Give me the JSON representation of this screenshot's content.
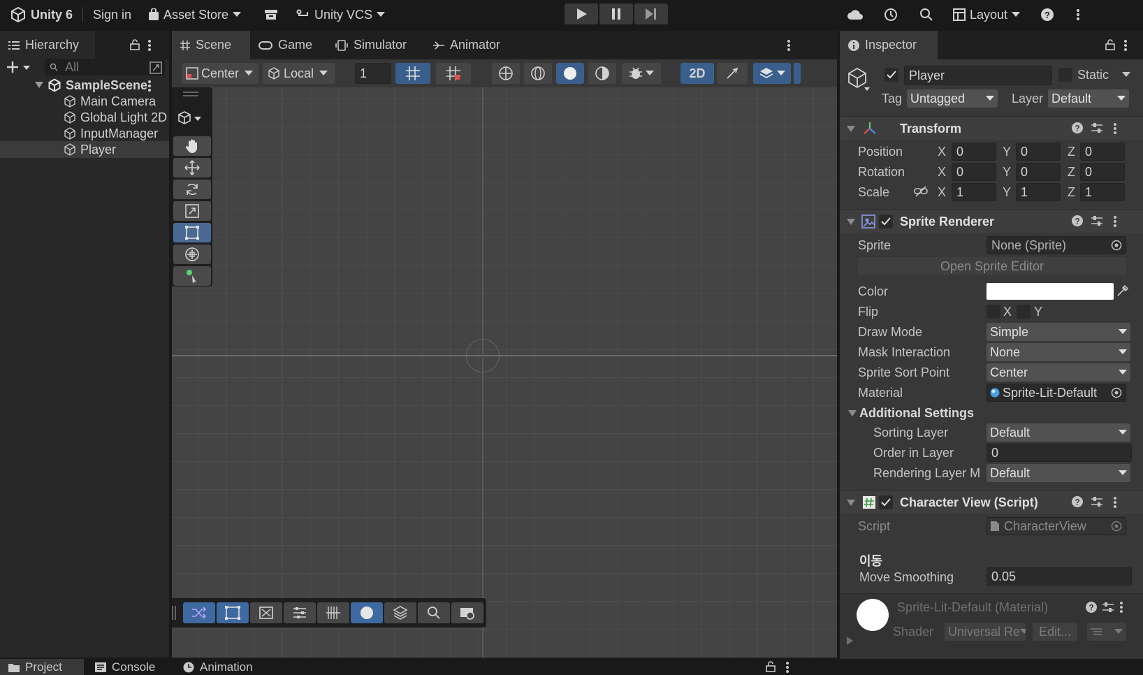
{
  "topbar": {
    "app_title": "Unity 6",
    "sign_in": "Sign in",
    "asset_store": "Asset Store",
    "vcs": "Unity VCS",
    "layout": "Layout"
  },
  "hierarchy": {
    "tab": "Hierarchy",
    "search_placeholder": "All",
    "scene": "SampleScene",
    "items": [
      "Main Camera",
      "Global Light 2D",
      "InputManager",
      "Player"
    ],
    "selected": "Player"
  },
  "center_tabs": [
    "Scene",
    "Game",
    "Simulator",
    "Animator"
  ],
  "scene_toolbar": {
    "pivot": "Center",
    "space": "Local",
    "snap_value": "1",
    "mode_2d": "2D"
  },
  "inspector": {
    "tab": "Inspector",
    "object_name": "Player",
    "static_label": "Static",
    "tag_label": "Tag",
    "tag_value": "Untagged",
    "layer_label": "Layer",
    "layer_value": "Default",
    "transform": {
      "title": "Transform",
      "position_label": "Position",
      "rotation_label": "Rotation",
      "scale_label": "Scale",
      "position": [
        "0",
        "0",
        "0"
      ],
      "rotation": [
        "0",
        "0",
        "0"
      ],
      "scale": [
        "1",
        "1",
        "1"
      ],
      "x": "X",
      "y": "Y",
      "z": "Z"
    },
    "sprite_renderer": {
      "title": "Sprite Renderer",
      "sprite_label": "Sprite",
      "sprite_value": "None (Sprite)",
      "open_editor": "Open Sprite Editor",
      "color_label": "Color",
      "color_value": "#ffffff",
      "flip_label": "Flip",
      "flip_x": "X",
      "flip_y": "Y",
      "draw_mode_label": "Draw Mode",
      "draw_mode": "Simple",
      "mask_label": "Mask Interaction",
      "mask": "None",
      "sort_point_label": "Sprite Sort Point",
      "sort_point": "Center",
      "material_label": "Material",
      "material": "Sprite-Lit-Default",
      "additional": "Additional Settings",
      "sorting_layer_label": "Sorting Layer",
      "sorting_layer": "Default",
      "order_label": "Order in Layer",
      "order": "0",
      "rendering_label": "Rendering Layer M",
      "rendering": "Default"
    },
    "character_view": {
      "title": "Character View (Script)",
      "script_label": "Script",
      "script_value": "CharacterView",
      "section": "이동",
      "move_label": "Move Smoothing",
      "move_value": "0.05"
    },
    "material_preview": {
      "title": "Sprite-Lit-Default (Material)",
      "shader_label": "Shader",
      "shader_value": "Universal Re",
      "edit": "Edit..."
    }
  },
  "bottom_tabs": [
    "Project",
    "Console",
    "Animation"
  ]
}
